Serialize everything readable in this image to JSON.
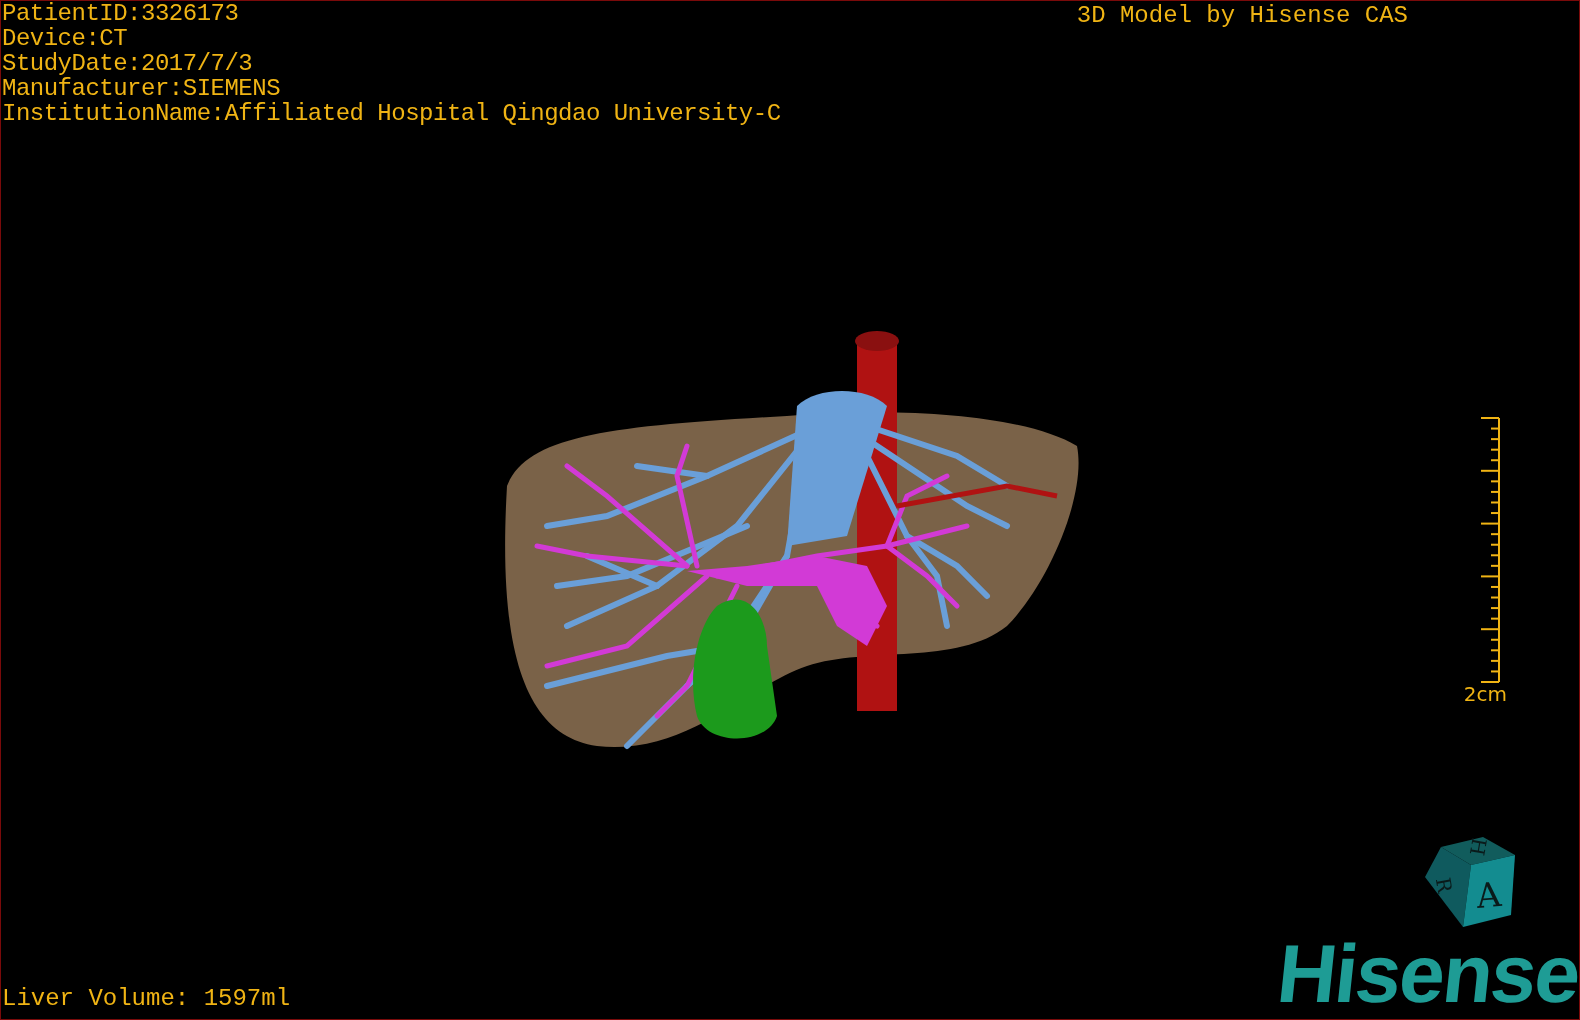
{
  "info_lines": [
    "PatientID:3326173",
    "Device:CT",
    "StudyDate:2017/7/3",
    "Manufacturer:SIEMENS",
    "InstitutionName:Affiliated Hospital Qingdao University-C"
  ],
  "title": "3D Model by Hisense CAS",
  "scale_bar": {
    "label": "2cm"
  },
  "liver_volume": "Liver Volume: 1597ml",
  "orientation_cube": {
    "faces": [
      "H",
      "R",
      "A"
    ]
  },
  "logo": "Hisense"
}
